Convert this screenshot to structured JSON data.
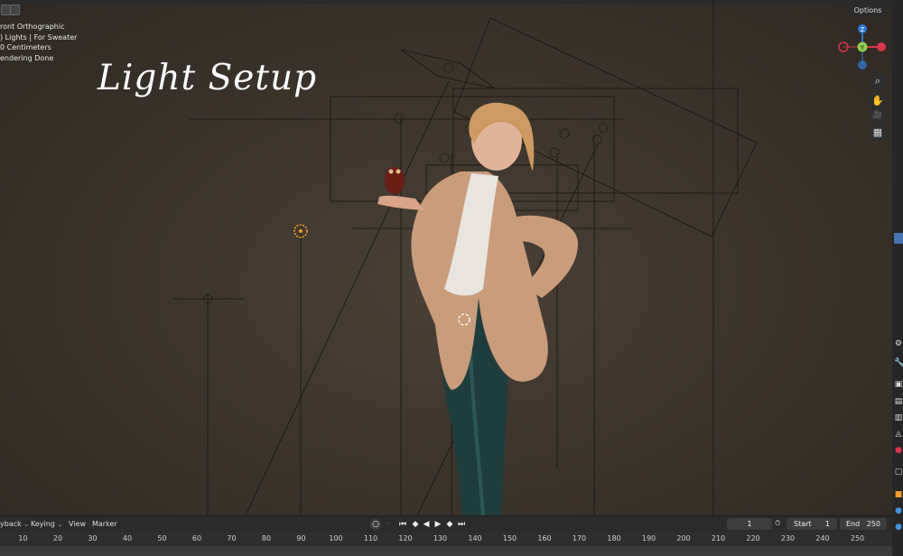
{
  "viewport": {
    "overlay_lines": [
      "ront Orthographic",
      ") Lights | For Sweater",
      "0 Centimeters",
      "endering Done"
    ],
    "title_text": "Light Setup",
    "options_label": "Options",
    "gizmo": {
      "z": "Z",
      "y": "Y",
      "x": "X"
    }
  },
  "nav_tools": [
    {
      "name": "zoom-icon",
      "glyph": "⌕"
    },
    {
      "name": "hand-icon",
      "glyph": "✋"
    },
    {
      "name": "camera-icon",
      "glyph": "🎥"
    },
    {
      "name": "grid-icon",
      "glyph": "▦"
    }
  ],
  "timeline": {
    "menus": [
      "yback",
      "Keying",
      "View",
      "Marker"
    ],
    "current_frame": "1",
    "start_label": "Start",
    "start_value": "1",
    "end_label": "End",
    "end_value": "250",
    "ruler_ticks": [
      "10",
      "20",
      "30",
      "40",
      "50",
      "60",
      "70",
      "80",
      "90",
      "100",
      "110",
      "120",
      "130",
      "140",
      "150",
      "160",
      "170",
      "180",
      "190",
      "200",
      "210",
      "220",
      "230",
      "240",
      "250"
    ]
  },
  "colors": {
    "viewport_bg": "#3d352c",
    "gizmo_x": "#d8344a",
    "gizmo_y": "#8fd14f",
    "gizmo_z": "#2d7ad6",
    "light_selected": "#f0a030"
  }
}
